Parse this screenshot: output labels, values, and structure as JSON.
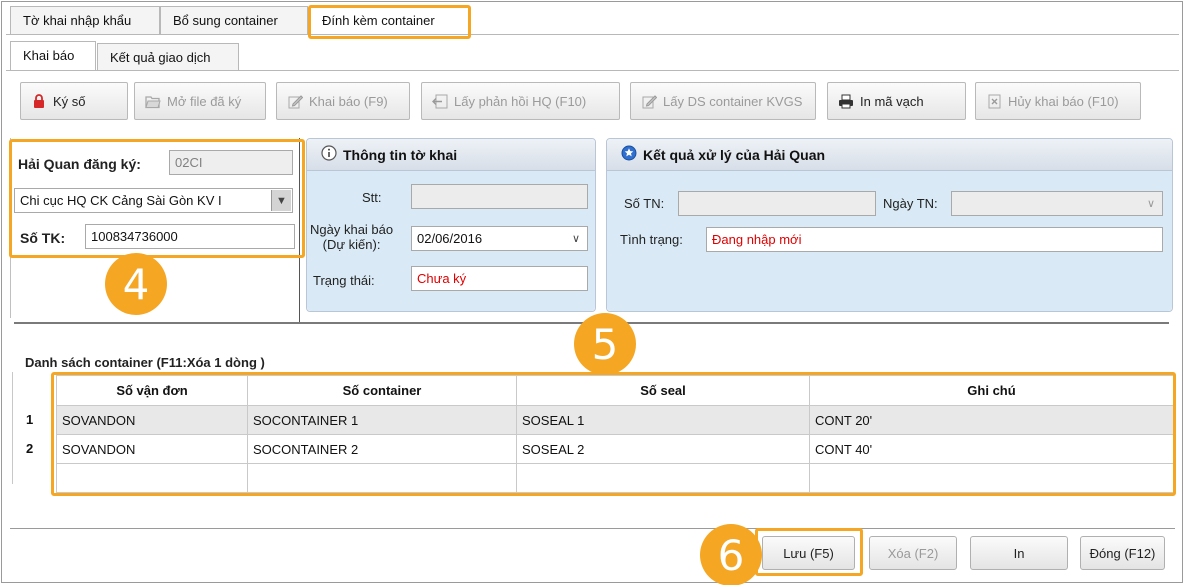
{
  "tabs": [
    {
      "label": "Tờ khai nhập khẩu"
    },
    {
      "label": "Bổ sung container"
    },
    {
      "label": "Đính kèm container"
    }
  ],
  "subtabs": [
    {
      "label": "Khai báo"
    },
    {
      "label": "Kết quả giao dịch"
    }
  ],
  "toolbar": {
    "ky_so": "Ký số",
    "mo_file": "Mở file đã ký",
    "khai_bao": "Khai báo (F9)",
    "lay_phan_hoi": "Lấy phản hồi HQ (F10)",
    "lay_ds": "Lấy DS container KVGS",
    "in_ma_vach": "In mã vạch",
    "huy_khai_bao": "Hủy khai báo (F10)"
  },
  "left_panel": {
    "hai_quan_label": "Hải Quan đăng ký:",
    "hai_quan_code": "02CI",
    "hai_quan_name": "Chi cục HQ CK Cảng Sài Gòn KV I",
    "so_tk_label": "Số TK:",
    "so_tk_value": "100834736000"
  },
  "thong_tin": {
    "title": "Thông tin tờ khai",
    "stt_label": "Stt:",
    "stt_value": "",
    "ngay_label_1": "Ngày khai báo",
    "ngay_label_2": "(Dự kiến):",
    "ngay_value": "02/06/2016",
    "trang_thai_label": "Trạng thái:",
    "trang_thai_value": "Chưa ký"
  },
  "ket_qua": {
    "title": "Kết quả xử lý của Hải Quan",
    "so_tn_label": "Số TN:",
    "so_tn_value": "",
    "ngay_tn_label": "Ngày TN:",
    "ngay_tn_value": "",
    "tinh_trang_label": "Tình trạng:",
    "tinh_trang_value": "Đang nhập mới"
  },
  "container_list": {
    "title": "Danh sách container (F11:Xóa 1 dòng )",
    "columns": [
      "Số vận đơn",
      "Số container",
      "Số seal",
      "Ghi chú"
    ],
    "rows": [
      {
        "num": "1",
        "van_don": "SOVANDON",
        "container": "SOCONTAINER 1",
        "seal": "SOSEAL 1",
        "ghi_chu": "CONT 20'"
      },
      {
        "num": "2",
        "van_don": "SOVANDON",
        "container": "SOCONTAINER 2",
        "seal": "SOSEAL 2",
        "ghi_chu": "CONT 40'"
      }
    ]
  },
  "bottom": {
    "luu": "Lưu (F5)",
    "xoa": "Xóa (F2)",
    "in": "In",
    "dong": "Đóng (F12)"
  },
  "callouts": {
    "c4": "4",
    "c5": "5",
    "c6": "6"
  },
  "colors": {
    "highlight": "#f5a623",
    "required_text": "#e00000",
    "panel_bg": "#d9eaf6"
  }
}
